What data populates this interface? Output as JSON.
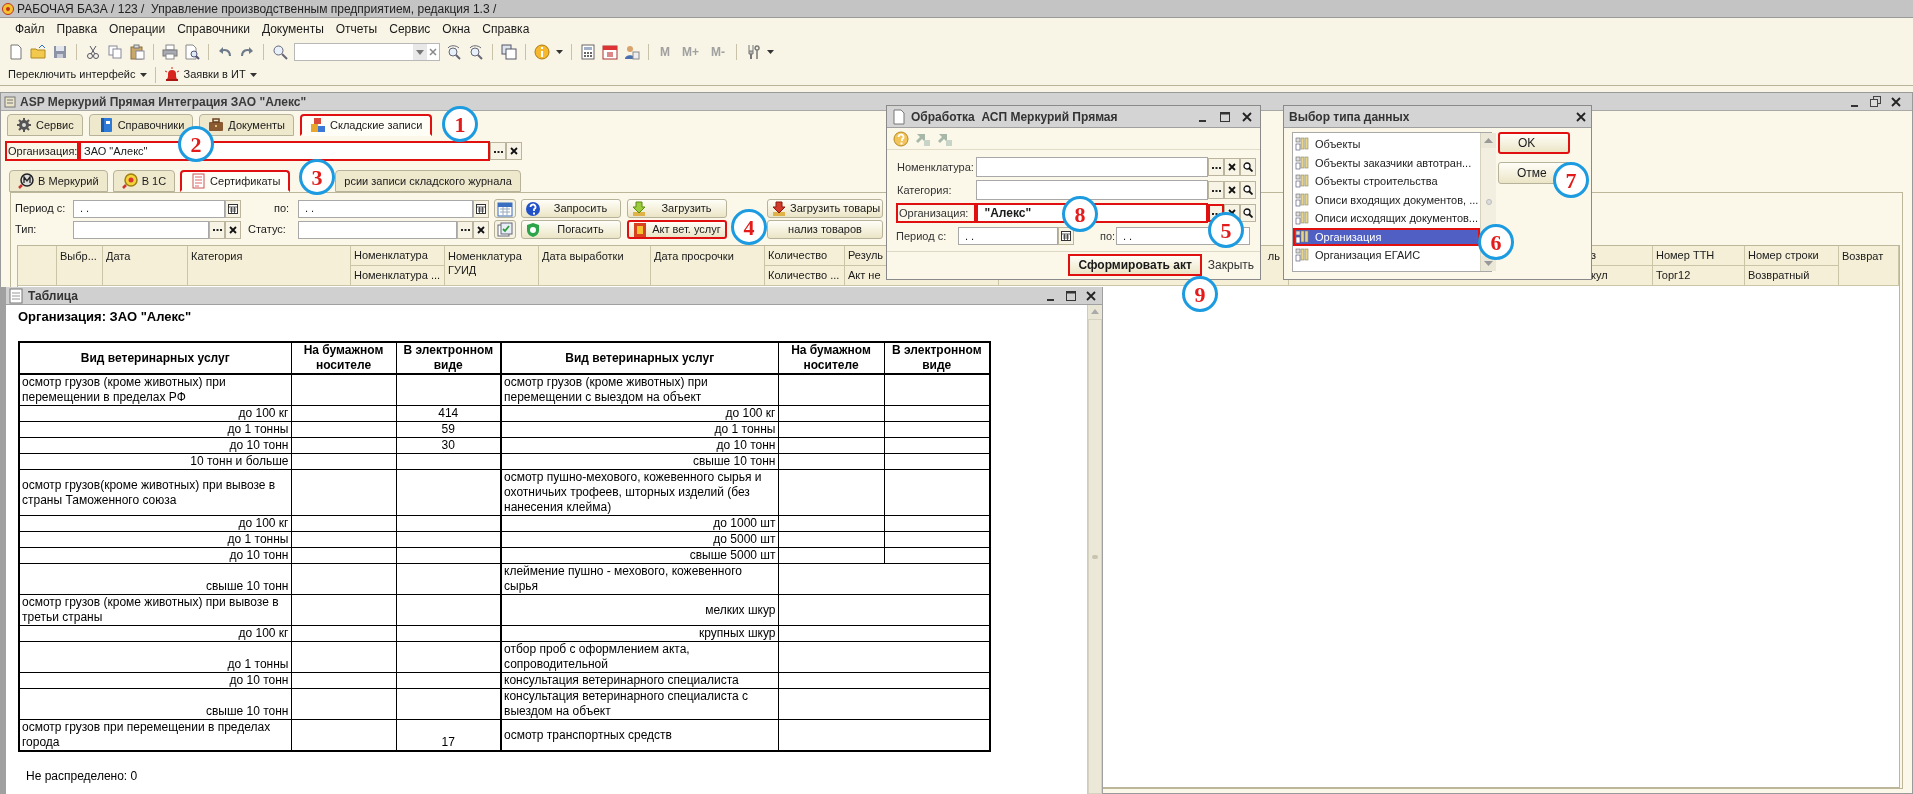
{
  "app_title": "РАБОЧАЯ БАЗА / 123 /  Управление производственным предприятием, редакция 1.3 /",
  "menu": [
    "Файл",
    "Правка",
    "Операции",
    "Справочники",
    "Документы",
    "Отчеты",
    "Сервис",
    "Окна",
    "Справка"
  ],
  "memory_buttons": [
    {
      "label": "M",
      "disabled": true
    },
    {
      "label": "M+",
      "disabled": true
    },
    {
      "label": "M-",
      "disabled": true
    }
  ],
  "quick_bar": [
    {
      "label": "Переключить интерфейс",
      "kind": "plain"
    },
    {
      "label": "Заявки в ИТ",
      "kind": "alarm"
    }
  ],
  "form": {
    "title": "ASP Меркурий Прямая Интеграция ЗАО \"Алекс\"",
    "tabs": [
      {
        "label": "Сервис",
        "kind": "service",
        "selected": false,
        "highlighted": false
      },
      {
        "label": "Справочники",
        "kind": "catalogs",
        "selected": false,
        "highlighted": false
      },
      {
        "label": "Документы",
        "kind": "documents",
        "selected": false,
        "highlighted": false
      },
      {
        "label": "Складские записи",
        "kind": "warehouse",
        "selected": true,
        "highlighted": true
      }
    ],
    "organization": {
      "label": "Организация:",
      "value": "ЗАО \"Алекс\"",
      "highlighted": true
    },
    "subtabs": [
      {
        "label": "В Меркурий",
        "kind": "mercury",
        "selected": false,
        "highlighted": false
      },
      {
        "label": "В 1С",
        "kind": "onec",
        "selected": false,
        "highlighted": false
      },
      {
        "label": "Сертификаты",
        "kind": "certificates",
        "selected": true,
        "highlighted": true
      },
      {
        "label": "рсии записи складского журнала",
        "kind": "plain",
        "selected": false,
        "highlighted": false
      }
    ],
    "filters": {
      "period_label": "Период с:",
      "period_from": ". .",
      "to_label": "по:",
      "period_to": ". .",
      "type_label": "Тип:",
      "status_label": "Статус:"
    },
    "buttons": [
      {
        "label": "Запросить",
        "kind": "query",
        "highlighted": false
      },
      {
        "label": "Загрузить",
        "kind": "download",
        "highlighted": false
      },
      {
        "label": "Загрузить товары",
        "kind": "download_goods",
        "highlighted": false
      },
      {
        "label": "Погасить",
        "kind": "redeem",
        "highlighted": false
      },
      {
        "label": "Акт вет. услуг",
        "kind": "act",
        "highlighted": true
      },
      {
        "label": "нализ товаров",
        "kind": "plain",
        "highlighted": false
      }
    ],
    "grid_columns": [
      {
        "title": "Выбр..."
      },
      {
        "title": "Дата"
      },
      {
        "title": "Категория"
      },
      {
        "title": "Номенклатура",
        "subtitle": "Номенклатура ..."
      },
      {
        "title": "Номенклатура ГУИД"
      },
      {
        "title": "Дата выработки"
      },
      {
        "title": "Дата просрочки"
      },
      {
        "title": "Количество",
        "subtitle": "Количество ..."
      },
      {
        "title": "Резуль",
        "subtitle": "Акт не"
      },
      {
        "title": "ль"
      },
      {
        "title": "з",
        "subtitle": "кул"
      },
      {
        "title": "Номер ТТН",
        "subtitle": "Торг12"
      },
      {
        "title": "Номер строки",
        "subtitle": "Возвратный"
      },
      {
        "title": "Возврат"
      }
    ]
  },
  "table_window": {
    "title": "Таблица",
    "heading": "Организация: ЗАО \"Алекс\"",
    "columns": [
      "Вид ветеринарных услуг",
      "На бумажном носителе",
      "В электронном виде",
      "Вид ветеринарных услуг",
      "На бумажном носителе",
      "В электронном виде"
    ],
    "rows": [
      {
        "left": {
          "text": "осмотр грузов (кроме животных) при перемещении в пределах РФ",
          "kind": "group"
        },
        "right": {
          "text": "осмотр грузов (кроме животных) при перемещении с выездом на объект",
          "kind": "group"
        },
        "right_merged": false
      },
      {
        "left": {
          "text": "до 100 кг",
          "kind": "item"
        },
        "left_electronic": "414",
        "right": {
          "text": "до 100 кг",
          "kind": "item"
        },
        "right_merged": false
      },
      {
        "left": {
          "text": "до 1 тонны",
          "kind": "item"
        },
        "left_electronic": "59",
        "right": {
          "text": "до 1 тонны",
          "kind": "item"
        },
        "right_merged": false
      },
      {
        "left": {
          "text": "до 10 тонн",
          "kind": "item"
        },
        "left_electronic": "30",
        "right": {
          "text": "до 10 тонн",
          "kind": "item"
        },
        "right_merged": false
      },
      {
        "left": {
          "text": "10 тонн и больше",
          "kind": "item"
        },
        "right": {
          "text": "свыше 10 тонн",
          "kind": "item"
        },
        "right_merged": false
      },
      {
        "left": {
          "text": "осмотр грузов(кроме животных) при вывозе в страны Таможенного союза",
          "kind": "group"
        },
        "right": {
          "text": "осмотр пушно-мехового, кожевенного сырья и охотничьих трофеев, шторных изделий (без нанесения клейма)",
          "kind": "group"
        },
        "right_merged": false
      },
      {
        "left": {
          "text": "до 100 кг",
          "kind": "item"
        },
        "right": {
          "text": "до 1000 шт",
          "kind": "item"
        },
        "right_merged": false
      },
      {
        "left": {
          "text": "до 1 тонны",
          "kind": "item"
        },
        "right": {
          "text": "до 5000 шт",
          "kind": "item"
        },
        "right_merged": false
      },
      {
        "left": {
          "text": "до 10 тонн",
          "kind": "item"
        },
        "right": {
          "text": "свыше 5000 шт",
          "kind": "item"
        },
        "right_merged": false
      },
      {
        "left": {
          "text": "свыше 10 тонн",
          "kind": "item"
        },
        "right": {
          "text": "клеймение пушно - мехового, кожевенного сырья",
          "kind": "group"
        },
        "right_merged": true
      },
      {
        "left": {
          "text": "осмотр грузов (кроме животных) при вывозе в третьи страны",
          "kind": "group"
        },
        "right": {
          "text": "мелких шкур",
          "kind": "item"
        },
        "right_merged": true
      },
      {
        "left": {
          "text": "до 100 кг",
          "kind": "item"
        },
        "right": {
          "text": "крупных шкур",
          "kind": "item"
        },
        "right_merged": true
      },
      {
        "left": {
          "text": "до 1 тонны",
          "kind": "item"
        },
        "right": {
          "text": "отбор проб с оформлением акта, сопроводительной",
          "kind": "group"
        },
        "right_merged": true
      },
      {
        "left": {
          "text": "до 10 тонн",
          "kind": "item"
        },
        "right": {
          "text": "консультация ветеринарного специалиста",
          "kind": "group"
        },
        "right_merged": true
      },
      {
        "left": {
          "text": "свыше 10 тонн",
          "kind": "item"
        },
        "right": {
          "text": "консультация ветеринарного специалиста с выездом на объект",
          "kind": "group"
        },
        "right_merged": true
      },
      {
        "left": {
          "text": "осмотр грузов при перемещении в пределах города",
          "kind": "group"
        },
        "left_electronic": "17",
        "right": {
          "text": "осмотр транспортных средств",
          "kind": "group"
        },
        "right_merged": true
      }
    ],
    "footer": "Не распределено: 0"
  },
  "processing_dialog": {
    "title": "Обработка  АСП Меркурий Прямая",
    "fields": [
      {
        "label": "Номенклатура:",
        "highlighted": false,
        "choose_highlighted": false
      },
      {
        "label": "Категория:",
        "highlighted": false,
        "choose_highlighted": false
      },
      {
        "label": "Организация:",
        "value": "\"Алекс\"",
        "highlighted": true,
        "choose_highlighted": true
      }
    ],
    "period": {
      "label": "Период с:",
      "from": ". .",
      "to_label": "по:",
      "to": ". ."
    },
    "actions": [
      {
        "label": "Сформировать акт",
        "kind": "default",
        "highlighted": true
      },
      {
        "label": "Закрыть",
        "kind": "plain",
        "highlighted": false
      }
    ]
  },
  "type_dialog": {
    "title": "Выбор типа данных",
    "items": [
      {
        "label": "Объекты",
        "selected": false,
        "highlighted": false
      },
      {
        "label": "Объекты заказчики автотран...",
        "selected": false,
        "highlighted": false
      },
      {
        "label": "Объекты строительства",
        "selected": false,
        "highlighted": false
      },
      {
        "label": "Описи входящих документов, ...",
        "selected": false,
        "highlighted": false
      },
      {
        "label": "Описи исходящих документов...",
        "selected": false,
        "highlighted": false
      },
      {
        "label": "Организация",
        "selected": true,
        "highlighted": true
      },
      {
        "label": "Организация ЕГАИС",
        "selected": false,
        "highlighted": false
      }
    ],
    "buttons": [
      {
        "label": "OK",
        "highlighted": true
      },
      {
        "label": "Отме",
        "highlighted": false
      }
    ]
  },
  "callouts": [
    {
      "number": "1"
    },
    {
      "number": "2"
    },
    {
      "number": "3"
    },
    {
      "number": "4"
    },
    {
      "number": "5"
    },
    {
      "number": "6"
    },
    {
      "number": "7"
    },
    {
      "number": "8"
    },
    {
      "number": "9"
    }
  ]
}
